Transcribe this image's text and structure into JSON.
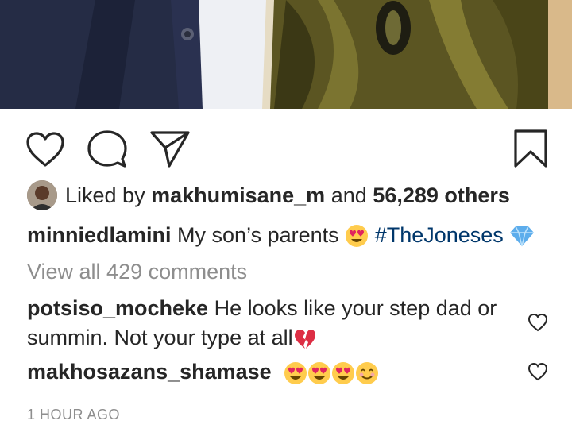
{
  "post": {
    "liked_by_prefix": "Liked by",
    "liked_by_user": "makhumisane_m",
    "liked_by_and": "and",
    "liked_by_others": "56,289 others",
    "caption_user": "minniedlamini",
    "caption_text": "My son’s parents",
    "caption_hashtag": "#TheJoneses",
    "view_all_comments": "View all 429 comments",
    "time_ago": "1 HOUR AGO"
  },
  "comments": [
    {
      "user": "potsiso_mocheke",
      "text_line1": "He looks like your step dad or",
      "text_line2": "summin. Not your type at all"
    },
    {
      "user": "makhosazans_shamase",
      "text": ""
    }
  ],
  "icons": [
    "heart-icon",
    "comment-icon",
    "share-icon",
    "bookmark-icon",
    "heart-eyes-emoji",
    "gem-emoji",
    "broken-heart-emoji",
    "smiling-emoji"
  ],
  "colors": {
    "text": "#262626",
    "muted": "#8e8e8e",
    "hashtag": "#00376b"
  }
}
